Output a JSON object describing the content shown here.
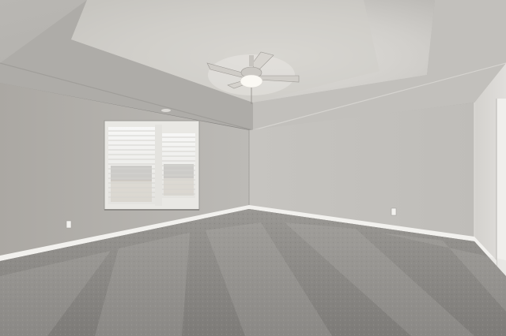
{
  "scene": {
    "subject": "empty-room",
    "colors": {
      "wall_left": "#b3b0ab",
      "wall_back": "#c4c2be",
      "wall_right": "#cfcdc9",
      "ceiling": "#c8c6c2",
      "tray": "#d8d6d2",
      "carpet": "#8c8a87",
      "baseboard": "#f2f1ee",
      "window_frame": "#e9e8e4",
      "blind": "#f4f4f2"
    }
  }
}
